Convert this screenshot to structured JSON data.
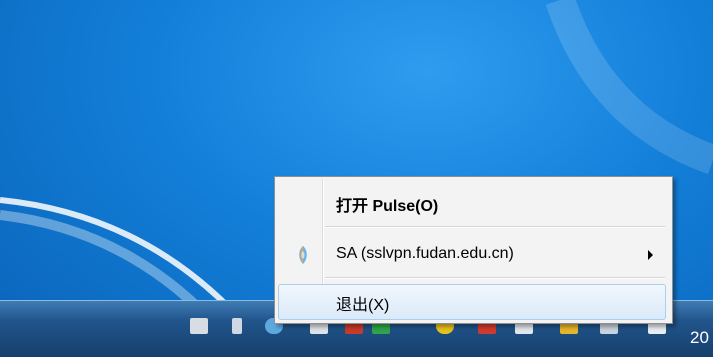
{
  "menu": {
    "items": [
      {
        "label": "打开 Pulse(O)",
        "icon": "none"
      },
      {
        "label": "SA (sslvpn.fudan.edu.cn)",
        "icon": "pulse-connection-icon",
        "has_submenu": true
      },
      {
        "label": "退出(X)",
        "icon": "none",
        "highlighted": true
      }
    ]
  },
  "taskbar": {
    "clock_partial": "20"
  },
  "colors": {
    "desktop": "#137fd9",
    "menu_background": "#f3f3f3",
    "highlight": "#dbeaf9"
  }
}
